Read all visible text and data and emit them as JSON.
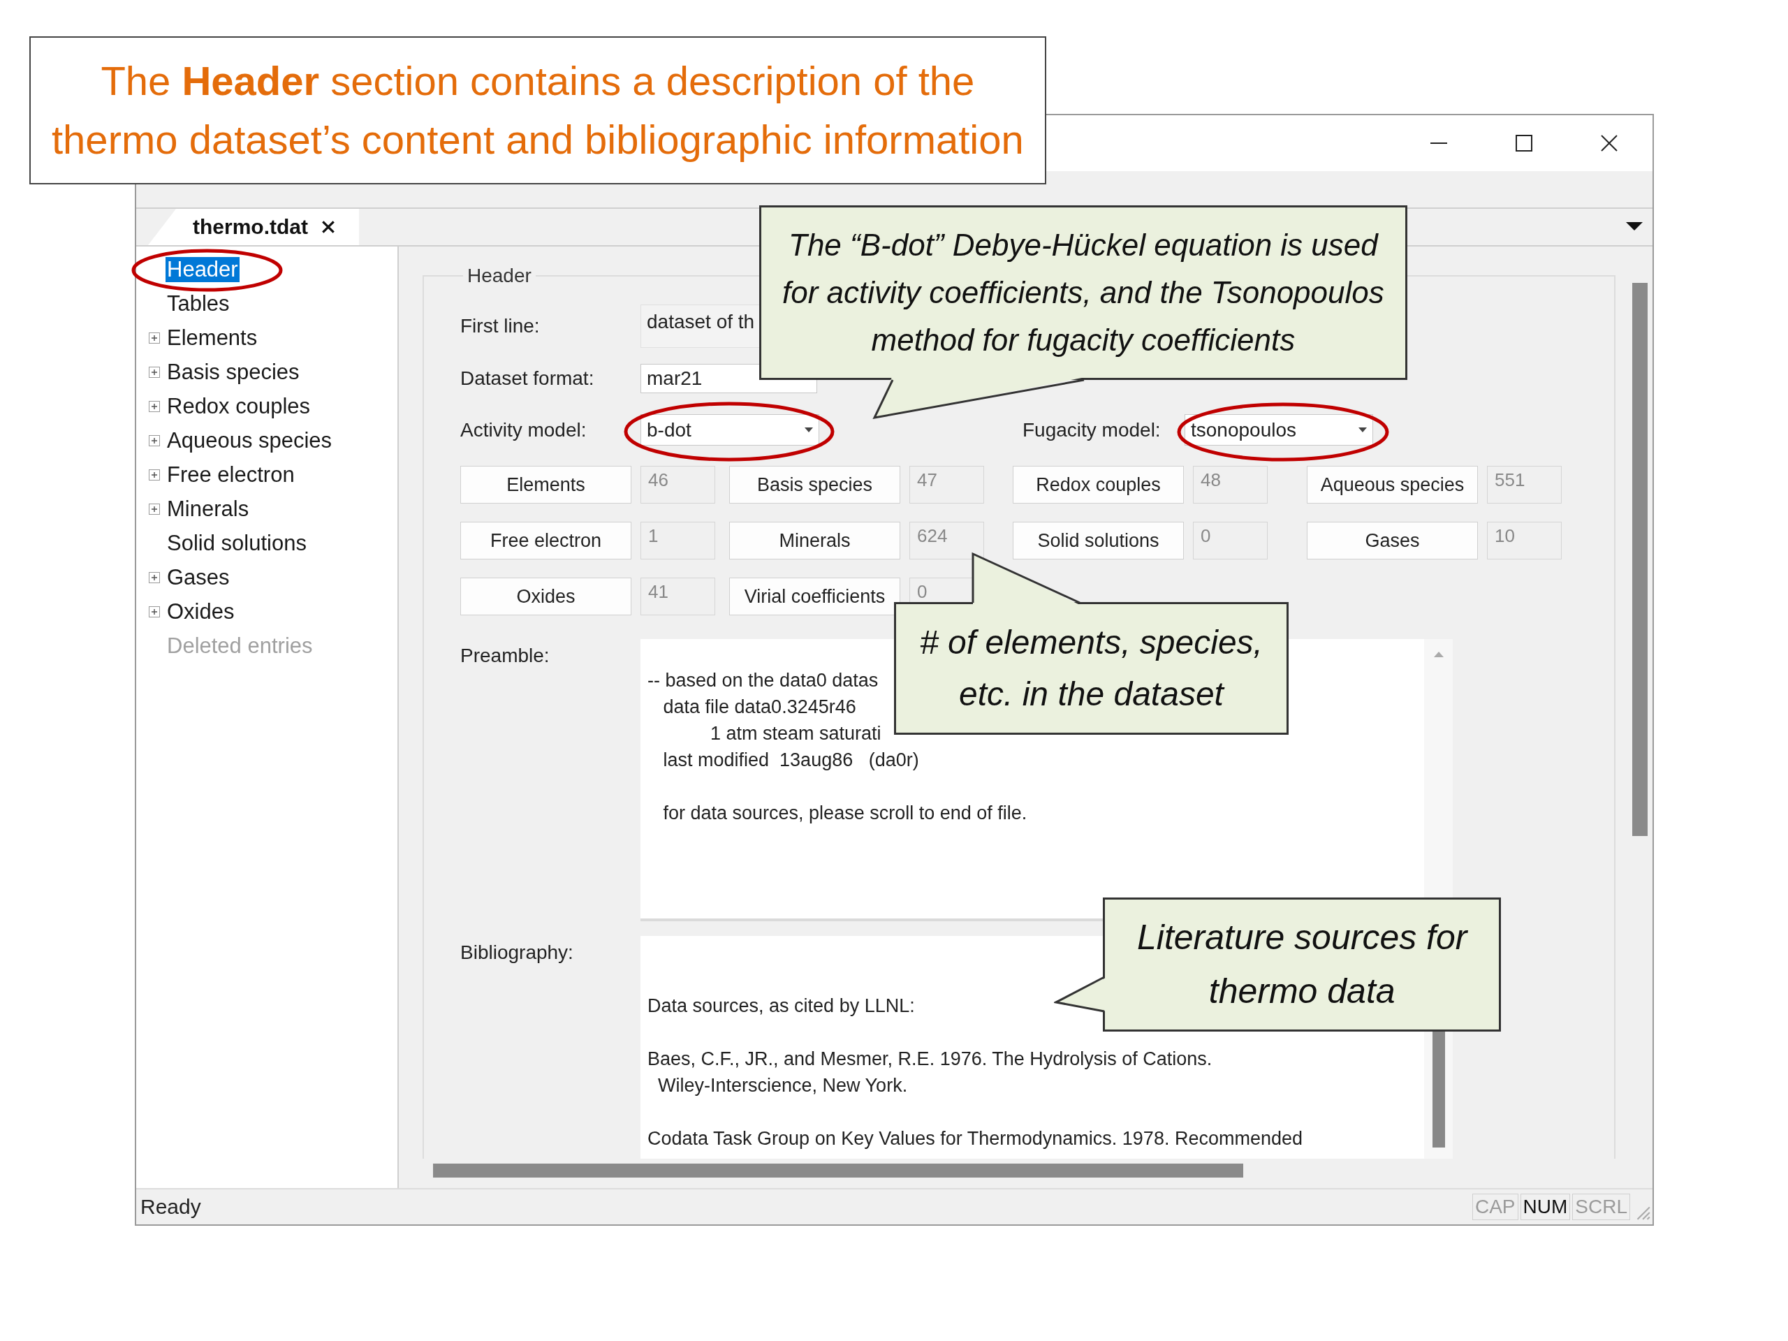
{
  "annotation_banner": {
    "lines": [
      "The **Header** section contains a description of the",
      "thermo dataset’s content and bibliographic information"
    ]
  },
  "window": {
    "tabs": [
      {
        "label": "thermo.tdat",
        "selected": true
      }
    ]
  },
  "tree": {
    "items": [
      {
        "label": "Header",
        "expander": false,
        "selected": true,
        "disabled": false
      },
      {
        "label": "Tables",
        "expander": false,
        "selected": false,
        "disabled": false
      },
      {
        "label": "Elements",
        "expander": true,
        "selected": false,
        "disabled": false
      },
      {
        "label": "Basis species",
        "expander": true,
        "selected": false,
        "disabled": false
      },
      {
        "label": "Redox couples",
        "expander": true,
        "selected": false,
        "disabled": false
      },
      {
        "label": "Aqueous species",
        "expander": true,
        "selected": false,
        "disabled": false
      },
      {
        "label": "Free electron",
        "expander": true,
        "selected": false,
        "disabled": false
      },
      {
        "label": "Minerals",
        "expander": true,
        "selected": false,
        "disabled": false
      },
      {
        "label": "Solid solutions",
        "expander": false,
        "selected": false,
        "disabled": false
      },
      {
        "label": "Gases",
        "expander": true,
        "selected": false,
        "disabled": false
      },
      {
        "label": "Oxides",
        "expander": true,
        "selected": false,
        "disabled": false
      },
      {
        "label": "Deleted entries",
        "expander": false,
        "selected": false,
        "disabled": true
      }
    ]
  },
  "header_group": {
    "title": "Header",
    "rows": [
      [
        {
          "label": "First line:",
          "value": "dataset of th",
          "kind": "text"
        }
      ],
      [
        {
          "label": "Dataset format:",
          "value": "mar21",
          "kind": "text"
        }
      ],
      [
        {
          "label": "Activity model:",
          "value": "b-dot",
          "kind": "dropdown"
        },
        {
          "label": "Fugacity model:",
          "value": "tsonopoulos",
          "kind": "dropdown"
        }
      ]
    ],
    "counts": [
      [
        {
          "label": "Elements",
          "value": "46"
        },
        {
          "label": "Basis species",
          "value": "47"
        },
        {
          "label": "Redox couples",
          "value": "48"
        },
        {
          "label": "Aqueous species",
          "value": "551"
        }
      ],
      [
        {
          "label": "Free electron",
          "value": "1"
        },
        {
          "label": "Minerals",
          "value": "624"
        },
        {
          "label": "Solid solutions",
          "value": "0"
        },
        {
          "label": "Gases",
          "value": "10"
        }
      ],
      [
        {
          "label": "Oxides",
          "value": "41"
        },
        {
          "label": "Virial coefficients",
          "value": "0"
        }
      ]
    ],
    "preamble": {
      "label": "Preamble:",
      "paragraphs": [
        [
          "-- based on the data0 datas",
          "   data file data0.3245r46",
          "            1 atm steam saturati",
          "   last modified  13aug86   (da0r)"
        ],
        [
          "   for data sources, please scroll to end of file."
        ]
      ]
    },
    "bibliography": {
      "label": "Bibliography:",
      "paragraphs": [
        [
          "Data sources, as cited by LLNL:"
        ],
        [
          "Baes, C.F., JR., and Mesmer, R.E. 1976. The Hydrolysis of Cations.",
          "  Wiley-Interscience, New York."
        ],
        [
          "Codata Task Group on Key Values for Thermodynamics. 1978. Recommended"
        ]
      ]
    }
  },
  "status_bar": {
    "text": "Ready",
    "indicators": [
      {
        "label": "CAP",
        "on": false
      },
      {
        "label": "NUM",
        "on": true
      },
      {
        "label": "SCRL",
        "on": false
      }
    ]
  },
  "callouts": [
    {
      "lines": [
        "The “B-dot” Debye-Hückel equation is used",
        "for activity coefficients, and the Tsonopoulos",
        "method for fugacity coefficients"
      ]
    },
    {
      "lines": [
        "# of elements, species,",
        "etc. in the dataset"
      ]
    },
    {
      "lines": [
        "Literature sources for",
        "thermo data"
      ]
    }
  ]
}
